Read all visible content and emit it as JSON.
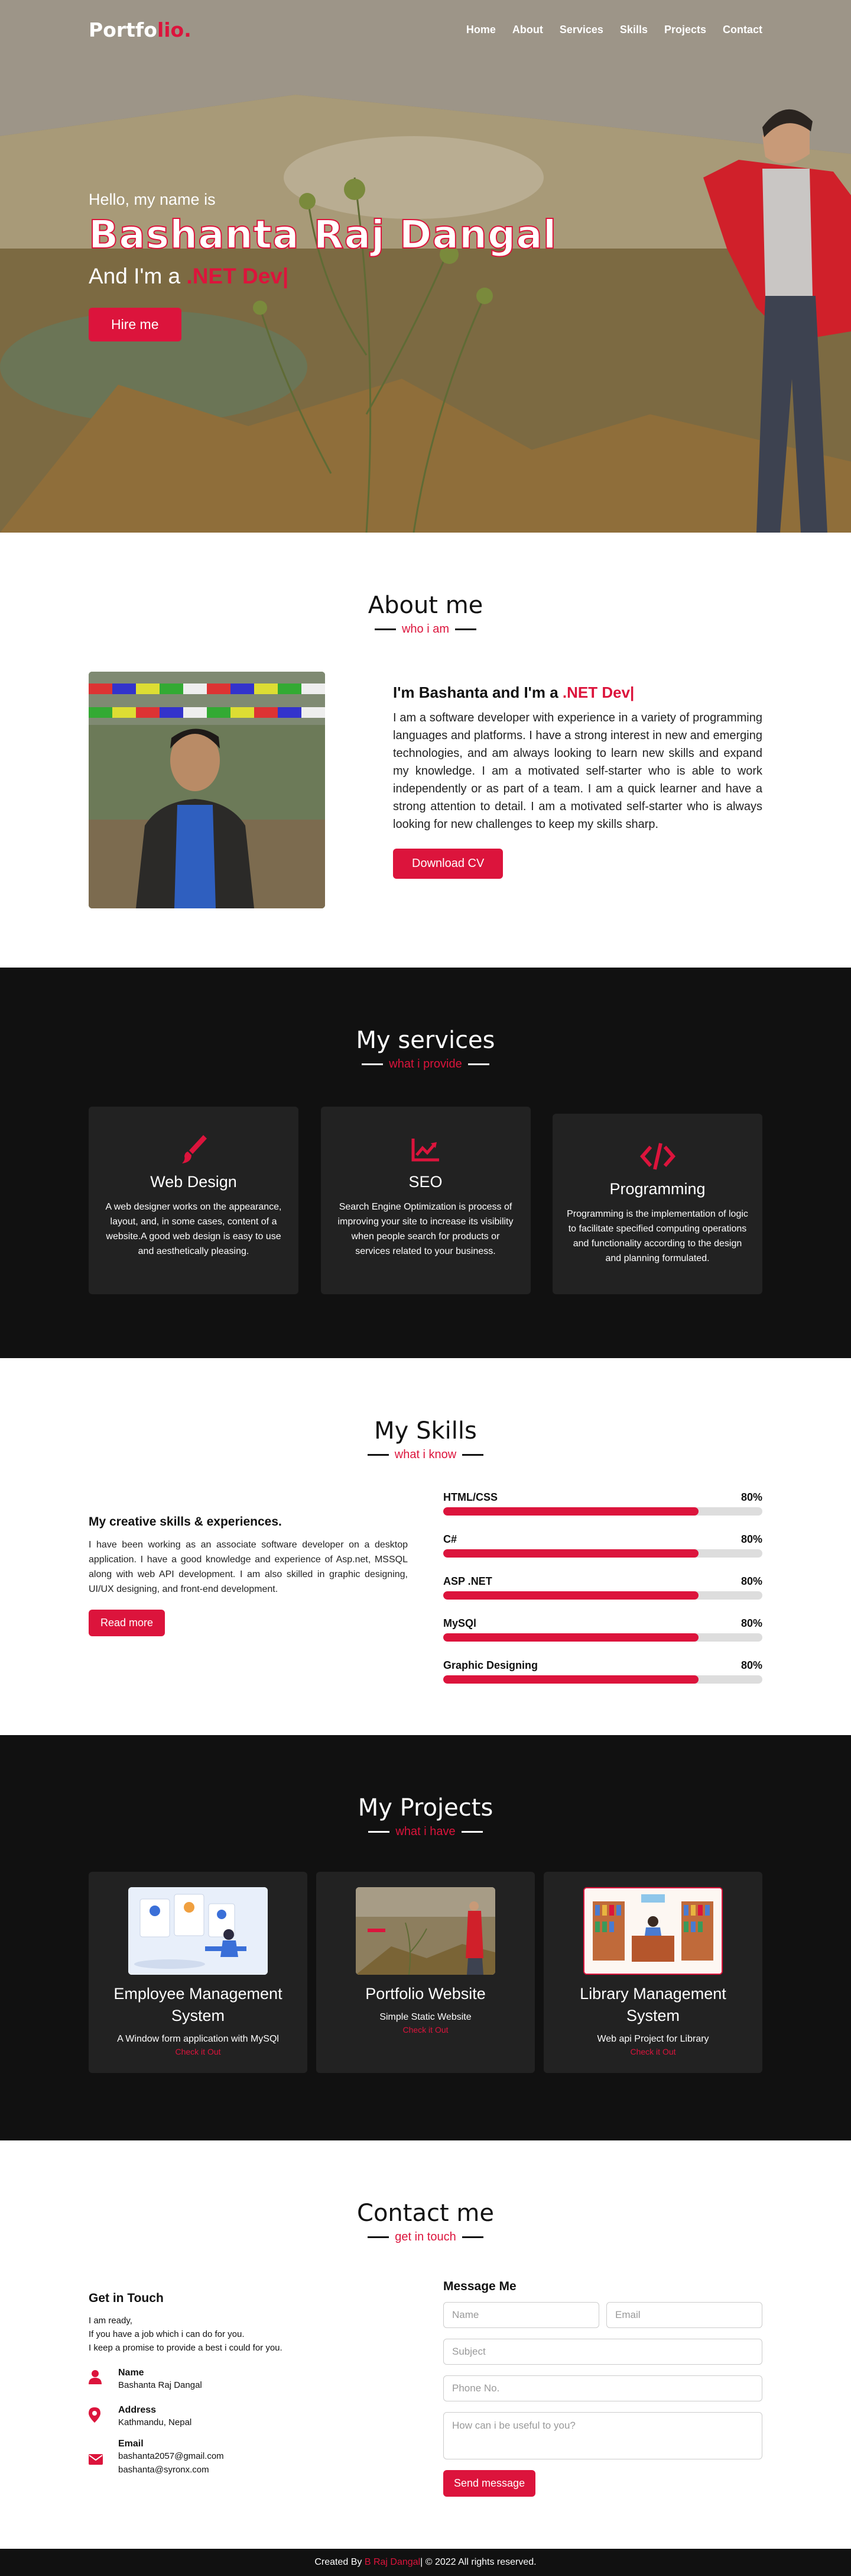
{
  "nav": {
    "logo_main": "Portfo",
    "logo_accent": "lio.",
    "items": [
      "Home",
      "About",
      "Services",
      "Skills",
      "Projects",
      "Contact"
    ]
  },
  "home": {
    "greeting": "Hello, my name is",
    "name": "Bashanta Raj Dangal",
    "role_prefix": "And I'm a ",
    "role": ".NET Dev|",
    "hire_label": "Hire me"
  },
  "about": {
    "title": "About me",
    "subtitle": "who i am",
    "heading_prefix": "I'm Bashanta and I'm a ",
    "heading_role": ".NET Dev|",
    "paragraph": "I am a software developer with experience in a variety of programming languages and platforms. I have a strong interest in new and emerging technologies, and am always looking to learn new skills and expand my knowledge. I am a motivated self-starter who is able to work independently or as part of a team. I am a quick learner and have a strong attention to detail. I am a motivated self-starter who is always looking for new challenges to keep my skills sharp.",
    "download_label": "Download CV"
  },
  "services": {
    "title": "My services",
    "subtitle": "what i provide",
    "cards": [
      {
        "icon": "paint-brush-icon",
        "title": "Web Design",
        "text": "A web designer works on the appearance, layout, and, in some cases, content of a website.A good web design is easy to use and aesthetically pleasing."
      },
      {
        "icon": "chart-line-icon",
        "title": "SEO",
        "text": "Search Engine Optimization is process of improving your site to increase its visibility when people search for products or services related to your business."
      },
      {
        "icon": "code-icon",
        "title": "Programming",
        "text": "Programming is the implementation of logic to facilitate specified computing operations and functionality according to the design and planning formulated."
      }
    ]
  },
  "skills": {
    "title": "My Skills",
    "subtitle": "what i know",
    "heading": "My creative skills & experiences.",
    "paragraph": "I have been working as an associate software developer on a desktop application. I have a good knowledge and experience of Asp.net, MSSQL along with web API development. I am also skilled in graphic designing, UI/UX designing, and front-end development.",
    "read_more": "Read more",
    "bars": [
      {
        "name": "HTML/CSS",
        "percent_label": "80%",
        "percent": 80
      },
      {
        "name": "C#",
        "percent_label": "80%",
        "percent": 80
      },
      {
        "name": "ASP .NET",
        "percent_label": "80%",
        "percent": 80
      },
      {
        "name": "MySQl",
        "percent_label": "80%",
        "percent": 80
      },
      {
        "name": "Graphic Designing",
        "percent_label": "80%",
        "percent": 80
      }
    ]
  },
  "projects": {
    "title": "My Projects",
    "subtitle": "what i have",
    "cards": [
      {
        "title": "Employee Management System",
        "desc": "A Window form application with MySQl",
        "link": "Check it Out"
      },
      {
        "title": "Portfolio Website",
        "desc": "Simple Static Website",
        "link": "Check it Out"
      },
      {
        "title": "Library Management System",
        "desc": "Web api Project for Library",
        "link": "Check it Out"
      }
    ]
  },
  "contact": {
    "title": "Contact me",
    "subtitle": "get in touch",
    "left_title": "Get in Touch",
    "intro": [
      "I am ready,",
      "If you have a job which i can do for you.",
      "I keep a promise to provide a best i could for you."
    ],
    "name_label": "Name",
    "name_value": "Bashanta Raj Dangal",
    "address_label": "Address",
    "address_value": "Kathmandu, Nepal",
    "email_label": "Email",
    "email_1": "bashanta2057@gmail.com",
    "email_2": "bashanta@syronx.com",
    "right_title": "Message Me",
    "ph_name": "Name",
    "ph_email": "Email",
    "ph_subject": "Subject",
    "ph_phone": "Phone No.",
    "ph_message": "How can i be useful to you?",
    "send_label": "Send message"
  },
  "footer": {
    "prefix": "Created By ",
    "author": "B Raj Dangal",
    "suffix": " | © 2022 All rights reserved."
  },
  "colors": {
    "accent": "#dc143c",
    "dark": "#111111",
    "card": "#222222"
  }
}
